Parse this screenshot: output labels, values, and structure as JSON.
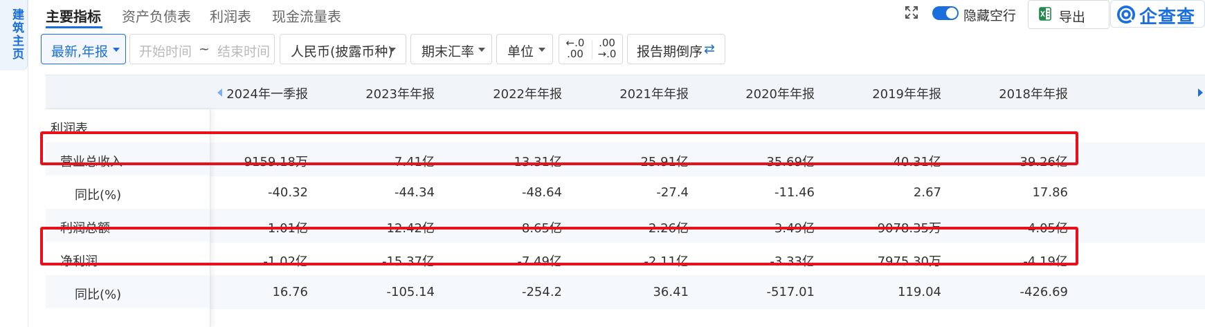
{
  "side_tab": {
    "label": "建筑主页"
  },
  "tabs": [
    {
      "label": "主要指标",
      "active": true
    },
    {
      "label": "资产负债表",
      "active": false
    },
    {
      "label": "利润表",
      "active": false
    },
    {
      "label": "现金流量表",
      "active": false
    }
  ],
  "header": {
    "hide_empty_label": "隐藏空行",
    "hide_empty_on": true,
    "export_label": "导出",
    "brand_name": "企查查"
  },
  "filters": {
    "period": "最新,年报",
    "start_placeholder": "开始时间",
    "range_sep": "~",
    "end_placeholder": "结束时间",
    "currency": "人民币(披露币种)",
    "rate": "期末汇率",
    "unit": "单位",
    "dec_minus_top": "←.0",
    "dec_minus_bottom": ".00",
    "dec_plus_top": ".00",
    "dec_plus_bottom": "→.0",
    "sort": "报告期倒序",
    "sort_icon": "⇄"
  },
  "table": {
    "columns": [
      "2024年一季报",
      "2023年年报",
      "2022年年报",
      "2021年年报",
      "2020年年报",
      "2019年年报",
      "2018年年报"
    ],
    "rows": [
      {
        "name": "利润表",
        "type": "section",
        "values": []
      },
      {
        "name": "营业总收入",
        "type": "metric",
        "highlighted": true,
        "values": [
          "9159.18万",
          "7.41亿",
          "13.31亿",
          "25.91亿",
          "35.69亿",
          "40.31亿",
          "39.26亿"
        ]
      },
      {
        "name": "同比(%)",
        "type": "sub",
        "values": [
          "-40.32",
          "-44.34",
          "-48.64",
          "-27.4",
          "-11.46",
          "2.67",
          "17.86"
        ]
      },
      {
        "name": "利润总额",
        "type": "metric",
        "values": [
          "-1.01亿",
          "-12.42亿",
          "-8.65亿",
          "-2.26亿",
          "-3.49亿",
          "9078.35万",
          "-4.05亿"
        ]
      },
      {
        "name": "净利润",
        "type": "metric",
        "highlighted": true,
        "values": [
          "-1.02亿",
          "-15.37亿",
          "-7.49亿",
          "-2.11亿",
          "-3.33亿",
          "7975.30万",
          "-4.19亿"
        ]
      },
      {
        "name": "同比(%)",
        "type": "sub",
        "values": [
          "16.76",
          "-105.14",
          "-254.2",
          "36.41",
          "-517.01",
          "119.04",
          "-426.69"
        ]
      }
    ]
  },
  "colors": {
    "accent": "#1a6fdc",
    "highlight": "#e8101a",
    "header_bg": "#f1f5fa"
  }
}
